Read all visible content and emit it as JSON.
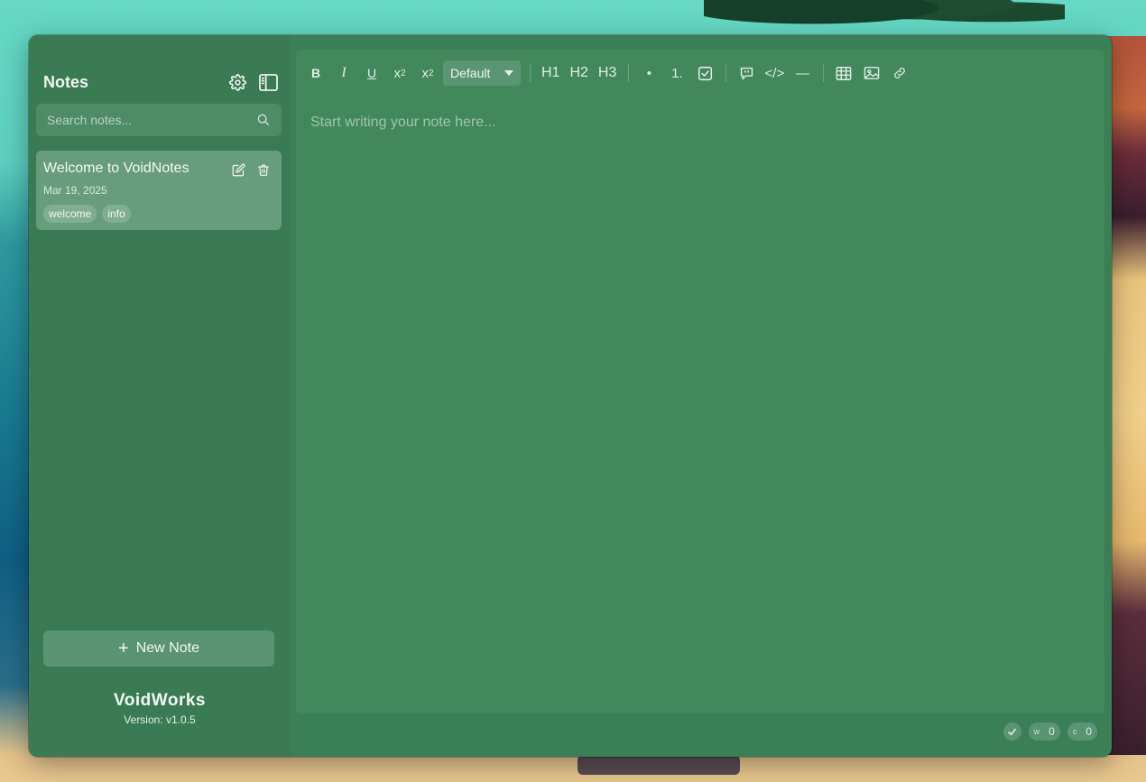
{
  "sidebar": {
    "title": "Notes",
    "search_placeholder": "Search notes...",
    "notes": [
      {
        "title": "Welcome to VoidNotes",
        "date": "Mar 19, 2025",
        "tags": [
          "welcome",
          "info"
        ]
      }
    ],
    "new_note_label": "New Note",
    "brand_name": "VoidWorks",
    "version": "Version: v1.0.5"
  },
  "toolbar": {
    "bold": "B",
    "italic": "I",
    "underline": "U",
    "superscript_base": "x",
    "superscript_mark": "2",
    "subscript_base": "x",
    "subscript_mark": "2",
    "font_select": "Default",
    "h1": "H1",
    "h2": "H2",
    "h3": "H3",
    "bullet": "•",
    "ordered": "1.",
    "code": "</>",
    "hr": "—"
  },
  "editor": {
    "placeholder": "Start writing your note here...",
    "value": ""
  },
  "status": {
    "words_label": "w",
    "words_count": "0",
    "chars_label": "c",
    "chars_count": "0"
  },
  "colors": {
    "window_bg": "#3b7f56",
    "editor_bg": "#42885b",
    "card_bg": "#679d7d"
  }
}
